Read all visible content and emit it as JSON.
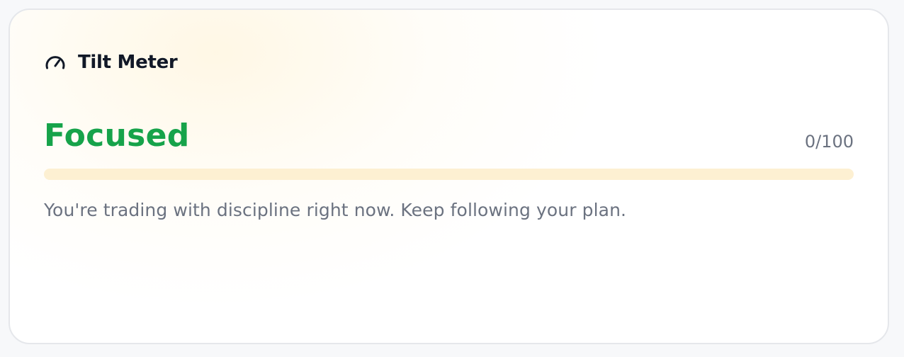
{
  "card": {
    "title": "Tilt Meter",
    "icon": "gauge-icon"
  },
  "status": {
    "label": "Focused",
    "score_text": "0/100",
    "score": 0,
    "max_score": 100,
    "color": "#16a34a"
  },
  "progress": {
    "fraction": 0,
    "track_color": "#fdf0d2"
  },
  "description": "You're trading with discipline right now. Keep following your plan."
}
